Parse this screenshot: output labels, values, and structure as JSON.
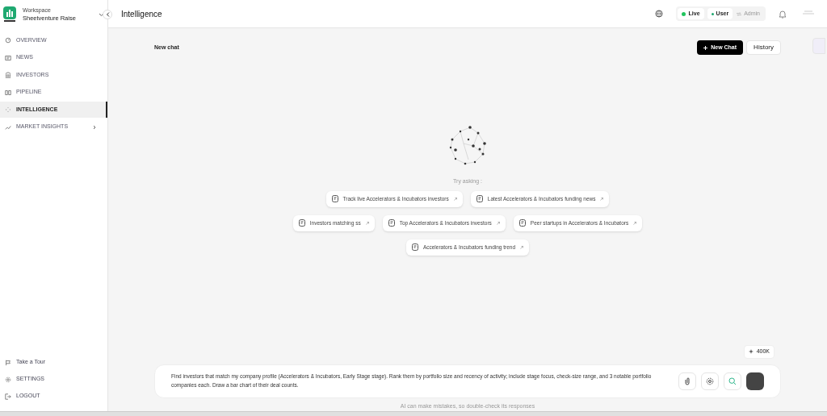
{
  "workspace": {
    "label": "Workspace",
    "name": "Sheetventure Raise"
  },
  "nav": [
    {
      "label": "OVERVIEW",
      "selected": false,
      "has_submenu": false
    },
    {
      "label": "NEWS",
      "selected": false,
      "has_submenu": false
    },
    {
      "label": "INVESTORS",
      "selected": false,
      "has_submenu": false
    },
    {
      "label": "PIPELINE",
      "selected": false,
      "has_submenu": false
    },
    {
      "label": "INTELLIGENCE",
      "selected": true,
      "has_submenu": false
    },
    {
      "label": "MARKET INSIGHTS",
      "selected": false,
      "has_submenu": true
    }
  ],
  "footer_nav": [
    {
      "label": "Take a Tour"
    },
    {
      "label": "SETTINGS"
    },
    {
      "label": "LOGOUT"
    }
  ],
  "header": {
    "title": "Intelligence",
    "live": {
      "label": "Live",
      "on": true
    },
    "roles": [
      {
        "label": "User",
        "selected": true
      },
      {
        "label": "Admin",
        "selected": false
      }
    ]
  },
  "chat": {
    "title": "New chat",
    "new_chat_button": "New Chat",
    "history_button": "History",
    "hint": "Try asking :",
    "suggestion_rows": [
      [
        "Track live Accelerators & Incubators investors",
        "Latest Accelerators & Incubators funding news"
      ],
      [
        "Investors matching ss",
        "Top Accelerators & Incubators investors",
        "Peer startups in Accelerators & Incubators"
      ],
      [
        "Accelerators & Incubators funding trend"
      ]
    ],
    "token_badge": "400K",
    "input_value": "Find investors that match my company profile (Accelerators & Incubators, Early Stage stage). Rank them by portfolio size and recency of activity; include stage focus, check-size range, and 3 notable portfolio companies each. Draw a bar chart of their deal counts.",
    "disclaimer": "AI can make mistakes, so double-check its responses"
  }
}
